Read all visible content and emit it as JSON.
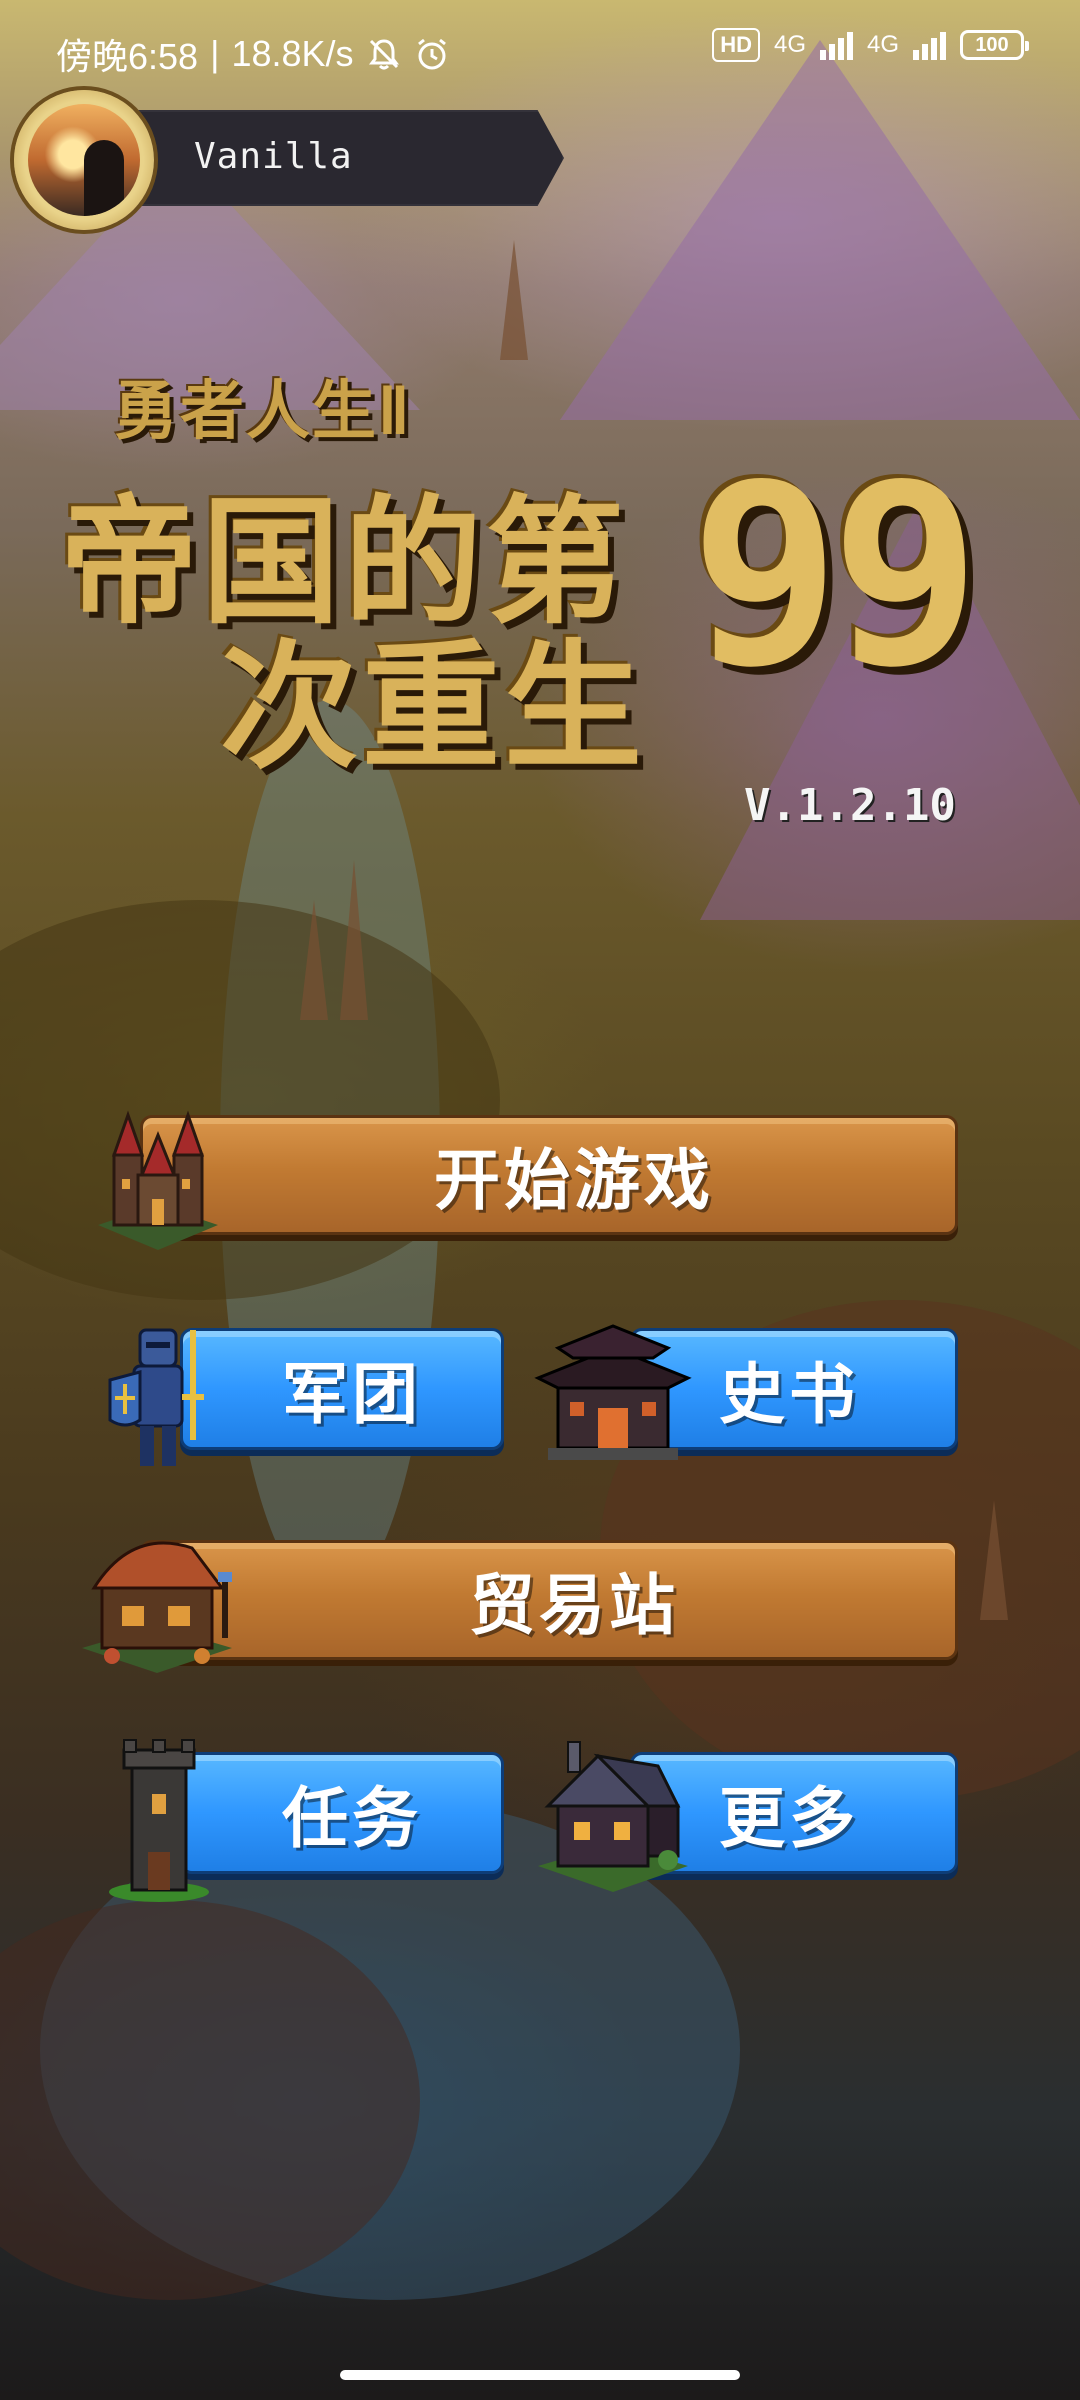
{
  "status_bar": {
    "time": "傍晚6:58",
    "separator": "|",
    "network_speed": "18.8K/s",
    "hd_label": "HD",
    "network_type_1": "4G",
    "network_type_2": "4G",
    "battery_level": "100",
    "icons": [
      "bell-muted-icon",
      "alarm-icon",
      "signal-icon",
      "battery-icon"
    ]
  },
  "profile": {
    "player_name": "Vanilla"
  },
  "title": {
    "subtitle": "勇者人生Ⅱ",
    "line1": "帝国的第",
    "line2": "次重生",
    "number": "99",
    "version": "V.1.2.10"
  },
  "menu": {
    "start_game": "开始游戏",
    "legion": "军团",
    "history_book": "史书",
    "trading_post": "贸易站",
    "quests": "任务",
    "more": "更多"
  },
  "colors": {
    "orange_button": "#c17a32",
    "blue_button": "#2f97ff",
    "title_gold": "#d9b25a"
  }
}
